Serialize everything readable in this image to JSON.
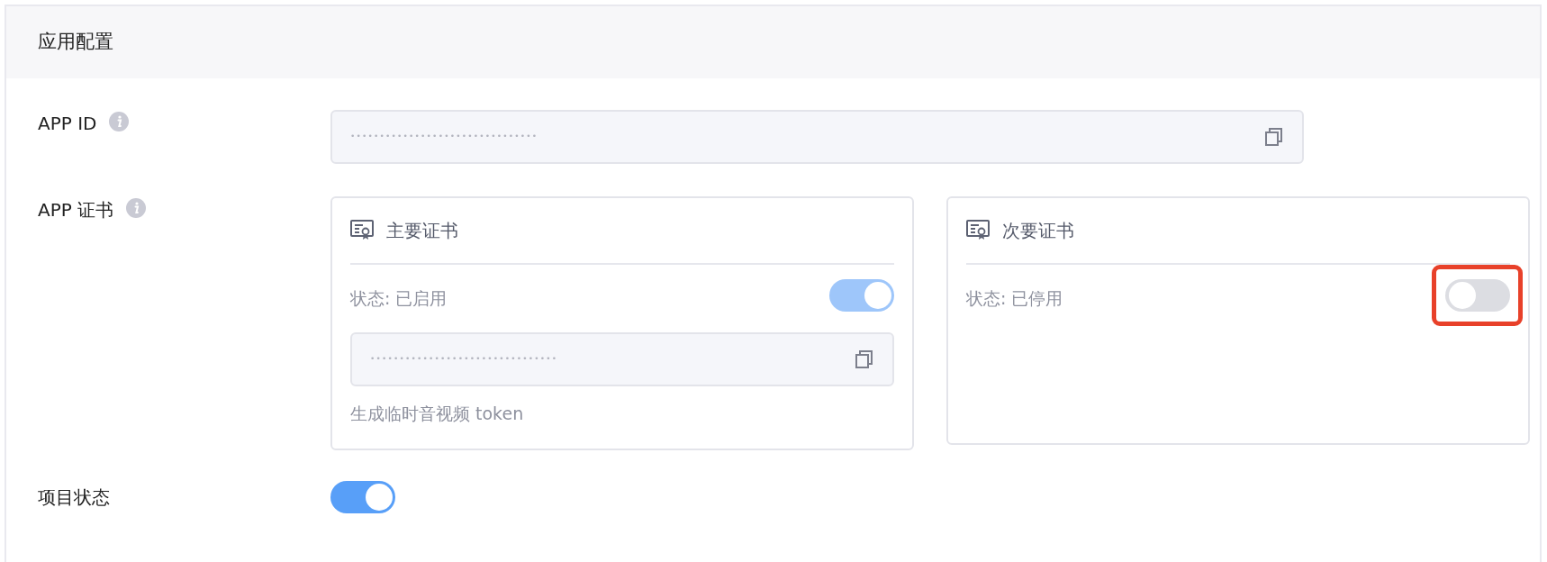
{
  "panel": {
    "title": "应用配置"
  },
  "fields": [
    {
      "label": "APP ID",
      "value": "••••••••••••••••••••••••••••••••"
    }
  ],
  "certificates_label": "APP 证书",
  "certificates": [
    {
      "title": "主要证书",
      "status": "状态: 已启用",
      "on": true,
      "disabled": true,
      "highlighted": false,
      "value": "••••••••••••••••••••••••••••••••",
      "link": "生成临时音视频 token"
    },
    {
      "title": "次要证书",
      "status": "状态: 已停用",
      "on": false,
      "disabled": false,
      "highlighted": true
    }
  ],
  "project_status": {
    "label": "项目状态",
    "on": true,
    "disabled": false
  }
}
